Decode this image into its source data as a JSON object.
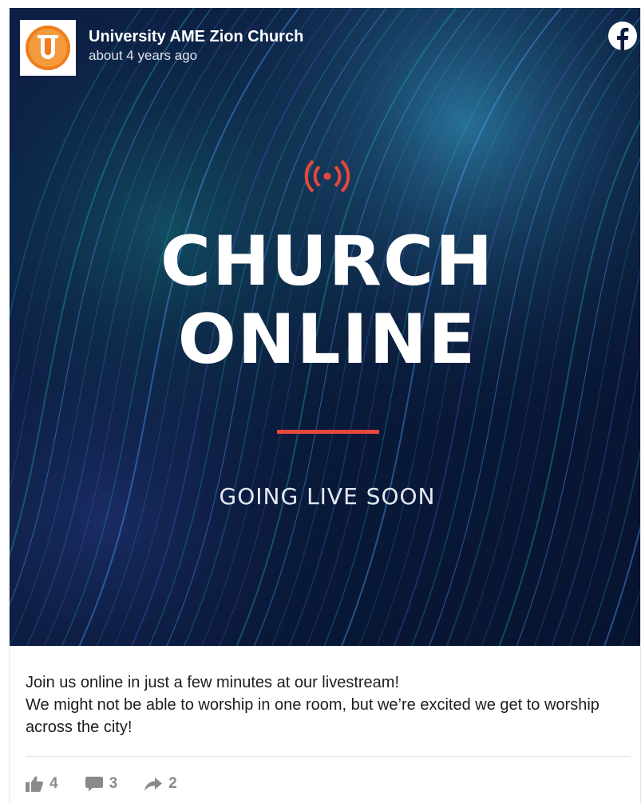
{
  "post": {
    "author": "University AME Zion Church",
    "time": "about 4 years ago",
    "platform_icon": "facebook-icon",
    "image": {
      "live_icon": "broadcast-icon",
      "line1": "CHURCH",
      "line2": "ONLINE",
      "subtitle": "GOING LIVE SOON",
      "accent_color": "#e8483c"
    },
    "caption_line1": "Join us online in just a few minutes at our livestream!",
    "caption_line2": "We might not be able to worship in one room, but we’re excited we get to worship across the city!",
    "likes": "4",
    "comments": "3",
    "shares": "2"
  },
  "colors": {
    "avatar_orange": "#f07d1a",
    "stat_gray": "#8a8a8a"
  }
}
